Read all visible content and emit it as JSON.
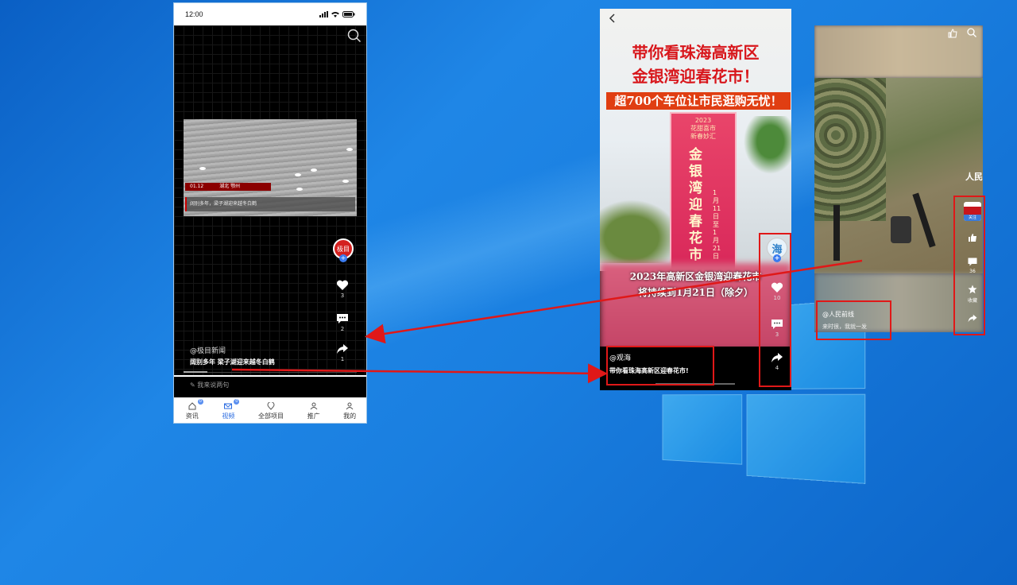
{
  "phone1": {
    "status_time": "12:00",
    "video_caption_date": "01.12",
    "video_caption_place": "湖北 鄂州",
    "video_caption_text": "阔别多年，梁子湖迎来越冬白鹤",
    "account_avatar": "极目",
    "like_count": "3",
    "comment_count": "2",
    "share_count": "1",
    "author": "@极目新闻",
    "title": "阔别多年   梁子湖迎来越冬白鹤",
    "comment_placeholder": "我来说两句",
    "tabs": [
      {
        "label": "资讯",
        "badge": "0"
      },
      {
        "label": "视频",
        "badge": "0"
      },
      {
        "label": "全部项目"
      },
      {
        "label": "推广"
      },
      {
        "label": "我的"
      }
    ],
    "active_tab": "视频"
  },
  "phone2": {
    "headline_line1": "带你看珠海高新区",
    "headline_line2": "金银湾迎春花市！",
    "band_text": "超700个车位让市民逛购无忧！",
    "banner_top": "2023\n花甜喜市\n新春妙汇",
    "banner_vertical": "金银湾迎春花市",
    "banner_date": "1月11日至1月21日",
    "subtitle_line1": "2023年高新区金银湾迎春花市",
    "subtitle_line2": "将持续到1月21日（除夕）",
    "avatar_char": "海",
    "like_count": "10",
    "comment_count": "3",
    "share_count": "4",
    "author": "@观海",
    "title": "带你看珠海高新区迎春花市!"
  },
  "phone3": {
    "follow_label": "关注",
    "comment_count": "36",
    "favorite_label": "收藏",
    "author": "@人民前线",
    "title": "来时很，我就一发",
    "side_text": "人民"
  },
  "colors": {
    "annotation_red": "#e01818",
    "tab_active": "#2a6be0",
    "avatar_red": "#d4201f"
  }
}
